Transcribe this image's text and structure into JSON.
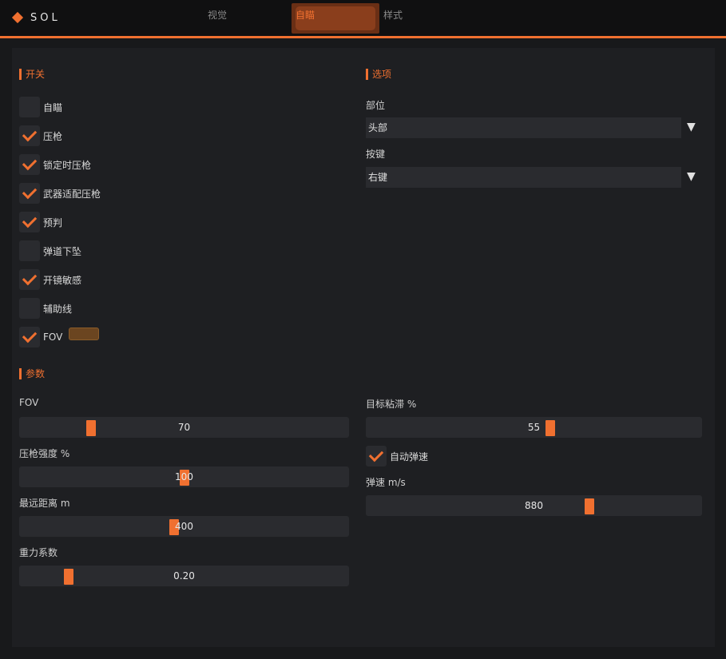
{
  "app": {
    "logo_text": "SOL"
  },
  "tabs": [
    {
      "label": "视觉",
      "active": false
    },
    {
      "label": "自瞄",
      "active": true
    },
    {
      "label": "样式",
      "active": false
    }
  ],
  "colors": {
    "accent": "#f07030",
    "fov_color_swatch": "#6b4520"
  },
  "sections": {
    "switches": "开关",
    "options": "选项",
    "params": "参数"
  },
  "switches": [
    {
      "label": "自瞄",
      "checked": false
    },
    {
      "label": "压枪",
      "checked": true
    },
    {
      "label": "锁定时压枪",
      "checked": true
    },
    {
      "label": "武器适配压枪",
      "checked": true
    },
    {
      "label": "预判",
      "checked": true
    },
    {
      "label": "弹道下坠",
      "checked": false
    },
    {
      "label": "开镜敏感",
      "checked": true
    },
    {
      "label": "辅助线",
      "checked": false
    },
    {
      "label": "FOV",
      "checked": true
    }
  ],
  "options": {
    "part_label": "部位",
    "part_value": "头部",
    "key_label": "按键",
    "key_value": "右键"
  },
  "params": {
    "fov": {
      "label": "FOV",
      "value": "70",
      "fraction": 0.21
    },
    "recoil": {
      "label": "压枪强度 %",
      "value": "100",
      "fraction": 0.5
    },
    "max_distance": {
      "label": "最远距离 m",
      "value": "400",
      "fraction": 0.47
    },
    "gravity": {
      "label": "重力系数",
      "value": "0.20",
      "fraction": 0.14
    },
    "stickiness": {
      "label": "目标粘滞 %",
      "value": "55",
      "fraction": 0.55
    },
    "auto_speed": {
      "label": "自动弹速",
      "checked": true
    },
    "bullet_speed": {
      "label": "弹速 m/s",
      "value": "880",
      "fraction": 0.67
    }
  }
}
